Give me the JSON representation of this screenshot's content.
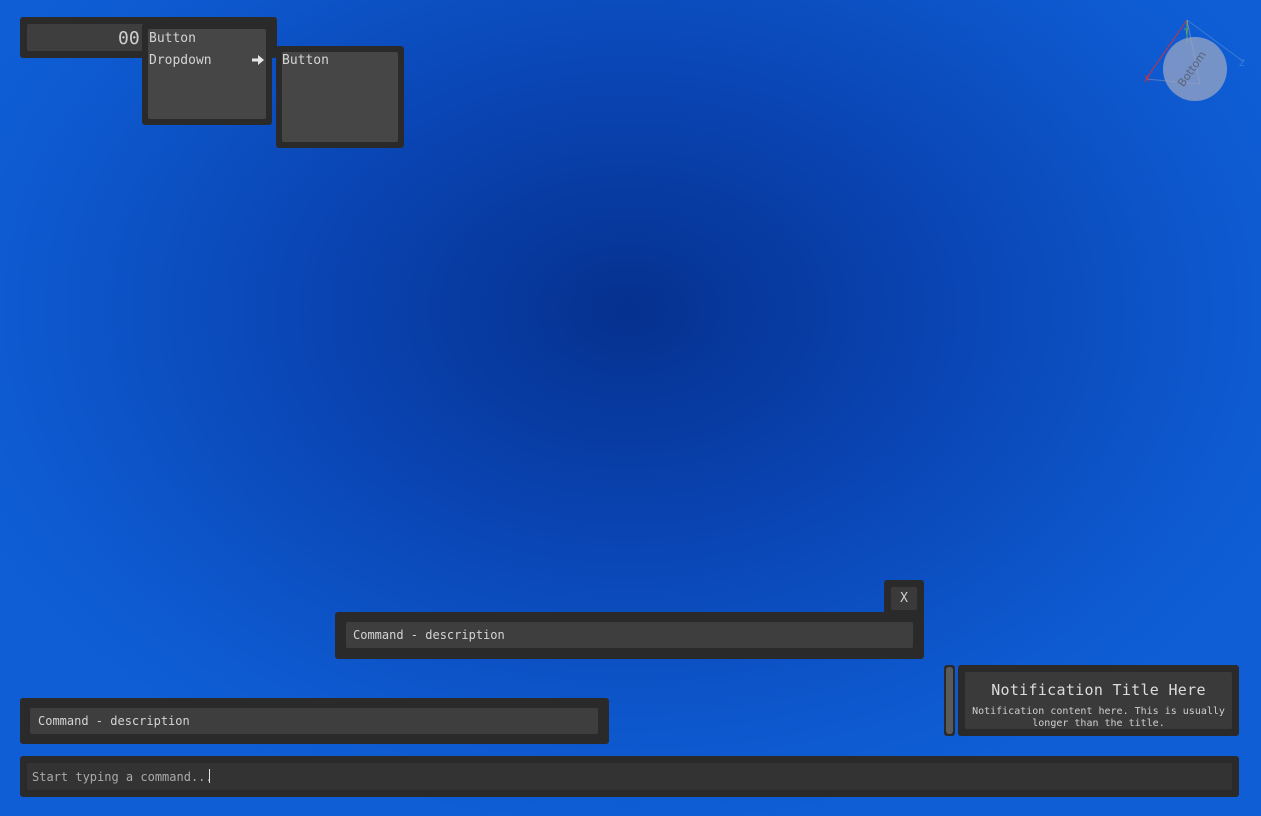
{
  "counter": {
    "value": "00"
  },
  "menu_primary": {
    "items": [
      {
        "label": "Button",
        "has_submenu": false
      },
      {
        "label": "Dropdown",
        "has_submenu": true,
        "icon": "arrow-right-icon"
      }
    ]
  },
  "menu_submenu": {
    "items": [
      {
        "label": "Button"
      }
    ]
  },
  "gizmo": {
    "face_label": "Bottom",
    "axes": [
      "X",
      "Y",
      "Z"
    ],
    "colors": {
      "x": "#d0303f",
      "y": "#6aa84f",
      "z": "#3a7bd5"
    }
  },
  "command_popup": {
    "close_label": "X",
    "row_text": "Command - description"
  },
  "command_list": {
    "row_text": "Command - description"
  },
  "notification": {
    "title": "Notification Title Here",
    "body": "Notification content here. This is usually longer than the title."
  },
  "command_input": {
    "placeholder": "Start typing a command..."
  }
}
